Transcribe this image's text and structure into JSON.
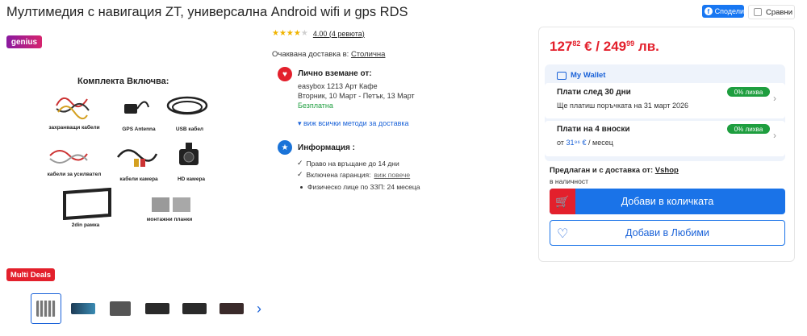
{
  "product": {
    "title": "Мултимедия с навигация ZT, универсална Android wifi и gps RDS",
    "share_label": "Сподели",
    "fb_glyph": "f",
    "compare_label": "Сравни",
    "genius_badge": "genius",
    "multi_deals_badge": "Multi Deals"
  },
  "image": {
    "caption": "Комплекта Включва:",
    "items": {
      "cables": "захранващи кабели",
      "gps": "GPS Antenna",
      "usb": "USB кабел",
      "amp": "кабели за усилвател",
      "camera_cables": "кабели камера",
      "hd": "HD камера",
      "frame": "2din рамка",
      "brackets": "монтажни планки"
    }
  },
  "rating": {
    "stars": 4,
    "text": "4.00 (4 ревюта)"
  },
  "delivery": {
    "label": "Очаквана доставка в:",
    "city": "Столична",
    "pickup_title": "Лично вземане от:",
    "pickup_place": "easybox 1213 Арт Кафе",
    "pickup_dates": "Вторник, 10 Март - Петък, 13 Март",
    "pickup_price": "Безплатна",
    "all_methods": "▾ виж всички методи за доставка"
  },
  "info": {
    "title": "Информация :",
    "return": "Право на връщане до 14 дни",
    "warranty": "Включена гаранция:",
    "warranty_more": "виж повече",
    "warranty_detail": "Физическо лице по ЗЗП: 24 месеца"
  },
  "price": {
    "eur_whole": "127",
    "eur_cents": "82",
    "eur_sign": "€ /",
    "bgn_whole": "249",
    "bgn_cents": "99",
    "bgn_sign": "лв."
  },
  "wallet": {
    "title": "My Wallet",
    "option1_title": "Плати след 30 дни",
    "option1_sub": "Ще платиш поръчката на 31 март 2026",
    "option2_title": "Плати на 4 вноски",
    "option2_prefix": "от",
    "option2_amount": "31⁹⁶ €",
    "option2_suffix": "/ месец",
    "badge": "0% лихва"
  },
  "seller": {
    "label": "Предлаган и с доставка от:",
    "name": "Vshop",
    "stock": "в наличност"
  },
  "actions": {
    "add_to_cart": "Добави в количката",
    "add_to_fav": "Добави в Любими"
  },
  "icons": {
    "pickup": "heart-pin-icon",
    "info": "star-badge-icon",
    "cart": "cart-icon",
    "heart": "heart-icon",
    "chevron": "chevron-right-icon"
  },
  "colors": {
    "accent_red": "#e3202c",
    "accent_blue": "#1a73e8",
    "green": "#1e9e3f"
  }
}
